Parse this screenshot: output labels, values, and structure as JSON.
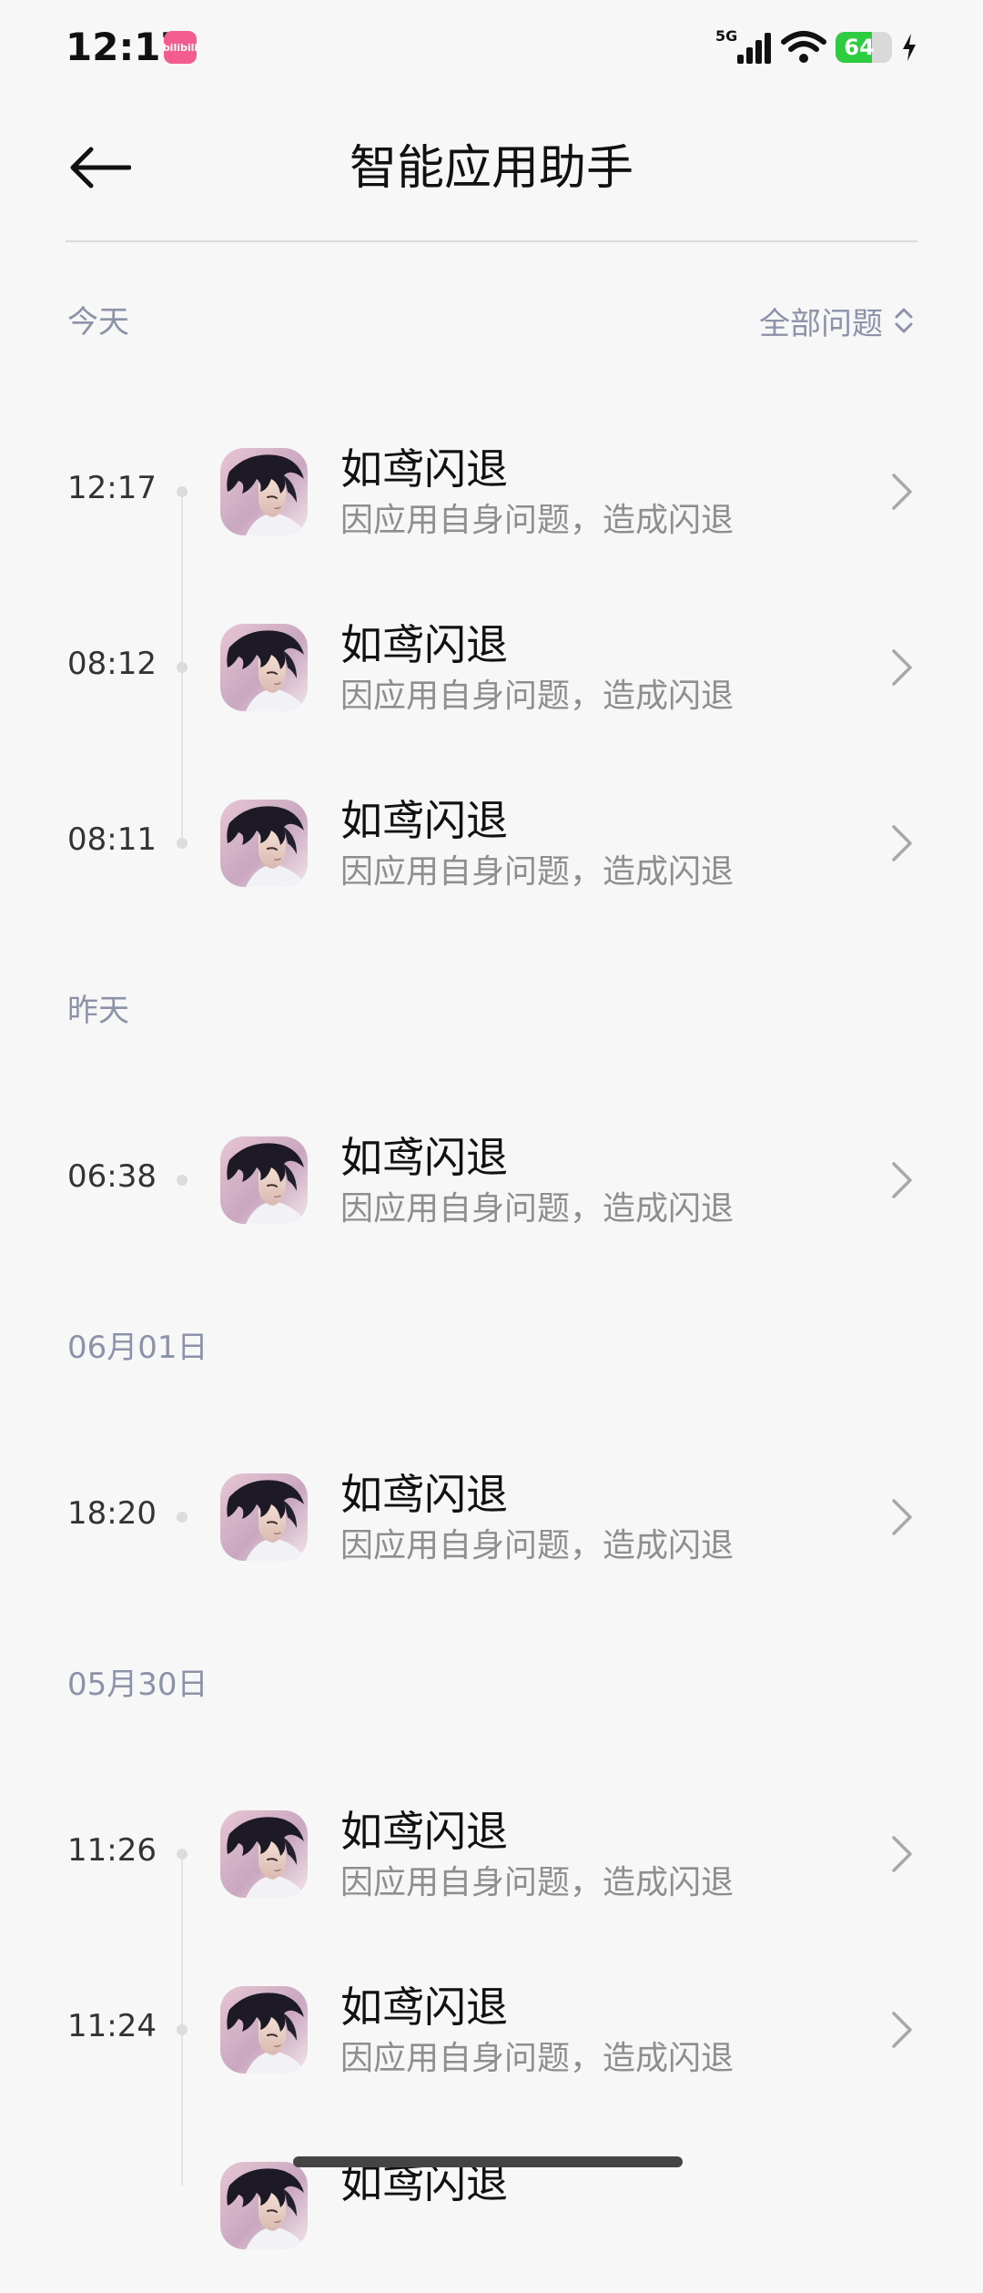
{
  "status_bar": {
    "time": "12:17",
    "app_badge": "bilibili",
    "network": "5G",
    "battery": "64",
    "battery_level": 0.64,
    "accent_green": "#2ecc40"
  },
  "header": {
    "title": "智能应用助手",
    "back_icon": "arrow-left-icon"
  },
  "filter": {
    "label": "全部问题",
    "icon": "chevron-up-down-icon"
  },
  "sections": [
    {
      "label": "今天",
      "items": [
        {
          "time": "12:17",
          "title": "如鸢闪退",
          "subtitle": "因应用自身问题，造成闪退"
        },
        {
          "time": "08:12",
          "title": "如鸢闪退",
          "subtitle": "因应用自身问题，造成闪退"
        },
        {
          "time": "08:11",
          "title": "如鸢闪退",
          "subtitle": "因应用自身问题，造成闪退"
        }
      ]
    },
    {
      "label": "昨天",
      "items": [
        {
          "time": "06:38",
          "title": "如鸢闪退",
          "subtitle": "因应用自身问题，造成闪退"
        }
      ]
    },
    {
      "label": "06月01日",
      "items": [
        {
          "time": "18:20",
          "title": "如鸢闪退",
          "subtitle": "因应用自身问题，造成闪退"
        }
      ]
    },
    {
      "label": "05月30日",
      "items": [
        {
          "time": "11:26",
          "title": "如鸢闪退",
          "subtitle": "因应用自身问题，造成闪退"
        },
        {
          "time": "11:24",
          "title": "如鸢闪退",
          "subtitle": "因应用自身问题，造成闪退"
        },
        {
          "time": "",
          "title": "如鸢闪退",
          "subtitle": ""
        }
      ]
    }
  ],
  "colors": {
    "background": "#f7f7f7",
    "section_label": "#8c93a8",
    "subtitle": "#8e8e8e"
  }
}
